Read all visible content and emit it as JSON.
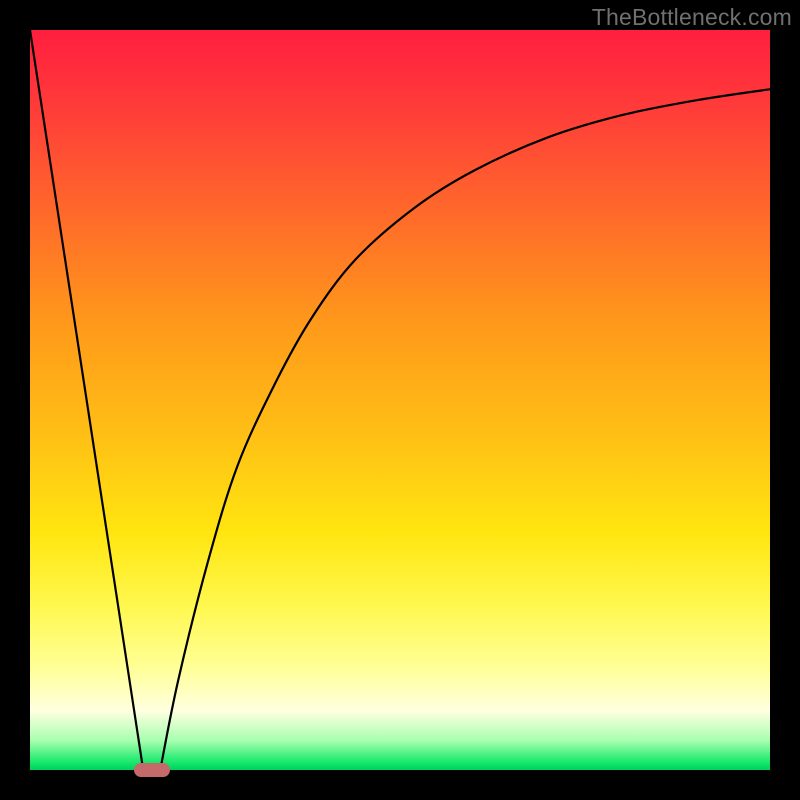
{
  "watermark": "TheBottleneck.com",
  "chart_data": {
    "type": "line",
    "title": "",
    "xlabel": "",
    "ylabel": "",
    "xlim": [
      0,
      100
    ],
    "ylim": [
      0,
      100
    ],
    "grid": false,
    "legend": false,
    "background_gradient_stops": [
      {
        "pos": 0,
        "color": "#ff1f3f"
      },
      {
        "pos": 25,
        "color": "#ff6a2a"
      },
      {
        "pos": 55,
        "color": "#ffc015"
      },
      {
        "pos": 78,
        "color": "#fff850"
      },
      {
        "pos": 92,
        "color": "#ffffe0"
      },
      {
        "pos": 99,
        "color": "#15e86a"
      },
      {
        "pos": 100,
        "color": "#00d060"
      }
    ],
    "series": [
      {
        "name": "left-branch",
        "x": [
          0,
          15.3
        ],
        "y": [
          100,
          0
        ]
      },
      {
        "name": "right-branch",
        "x": [
          17.6,
          20,
          24,
          28,
          33,
          38,
          44,
          52,
          60,
          70,
          80,
          90,
          100
        ],
        "y": [
          0,
          12,
          28,
          41,
          52,
          61,
          69,
          76,
          81,
          85.5,
          88.5,
          90.5,
          92
        ]
      }
    ],
    "marker": {
      "x": 16.5,
      "y": 0,
      "color": "#c46a6a"
    }
  }
}
